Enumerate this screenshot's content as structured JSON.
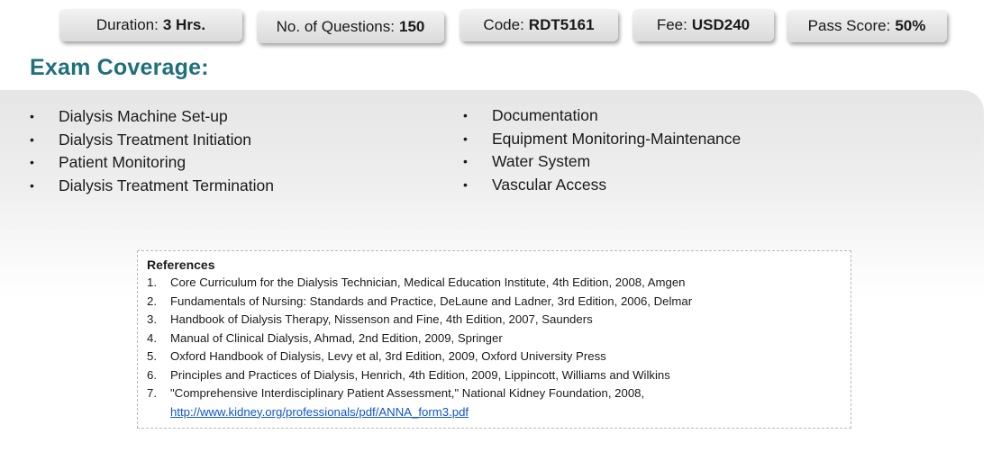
{
  "stats": [
    {
      "label": "Duration:",
      "value": "3 Hrs."
    },
    {
      "label": "No. of Questions:",
      "value": "150"
    },
    {
      "label": "Code:",
      "value": "RDT5161"
    },
    {
      "label": "Fee:",
      "value": "USD240"
    },
    {
      "label": "Pass Score:",
      "value": "50%"
    }
  ],
  "coverage": {
    "title": "Exam Coverage:",
    "bullet": "•",
    "left": [
      "Dialysis Machine Set-up",
      "Dialysis Treatment Initiation",
      "Patient Monitoring",
      "Dialysis Treatment Termination"
    ],
    "right": [
      "Documentation",
      "Equipment Monitoring-Maintenance",
      "Water System",
      "Vascular Access"
    ]
  },
  "references": {
    "title": "References",
    "items": [
      {
        "num": "1.",
        "text": "Core Curriculum for the Dialysis Technician, Medical Education Institute, 4th Edition, 2008, Amgen"
      },
      {
        "num": "2.",
        "text": "Fundamentals of Nursing: Standards and Practice, DeLaune and Ladner, 3rd Edition, 2006, Delmar"
      },
      {
        "num": "3.",
        "text": "Handbook of Dialysis Therapy, Nissenson and Fine, 4th Edition, 2007, Saunders"
      },
      {
        "num": "4.",
        "text": "Manual of Clinical Dialysis, Ahmad, 2nd Edition, 2009, Springer"
      },
      {
        "num": "5.",
        "text": "Oxford Handbook of Dialysis, Levy et al, 3rd Edition, 2009, Oxford University Press"
      },
      {
        "num": "6.",
        "text": "Principles and Practices of Dialysis, Henrich, 4th Edition, 2009, Lippincott, Williams and Wilkins"
      },
      {
        "num": "7.",
        "text": "\"Comprehensive Interdisciplinary Patient Assessment,\" National Kidney Foundation, 2008,",
        "link": "http://www.kidney.org/professionals/pdf/ANNA_form3.pdf"
      }
    ]
  },
  "colors": {
    "heading": "#1f6f7d",
    "link": "#1155cc",
    "pill_top": "#f2f2f2",
    "pill_bottom": "#dadada",
    "band": "#e6e6e6"
  }
}
